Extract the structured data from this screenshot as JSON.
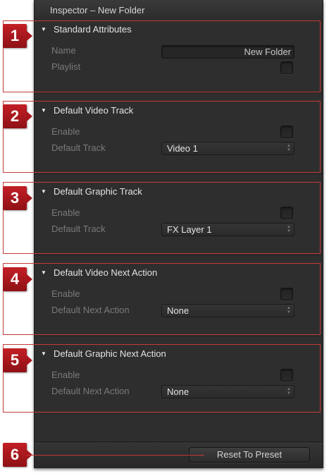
{
  "inspector": {
    "title": "Inspector – New Folder"
  },
  "sections": [
    {
      "header": "Standard Attributes",
      "name_label": "Name",
      "name_value": "New Folder",
      "playlist_label": "Playlist"
    },
    {
      "header": "Default Video Track",
      "enable_label": "Enable",
      "track_label": "Default Track",
      "track_value": "Video 1"
    },
    {
      "header": "Default Graphic Track",
      "enable_label": "Enable",
      "track_label": "Default Track",
      "track_value": "FX Layer 1"
    },
    {
      "header": "Default Video Next Action",
      "enable_label": "Enable",
      "action_label": "Default Next Action",
      "action_value": "None"
    },
    {
      "header": "Default Graphic Next Action",
      "enable_label": "Enable",
      "action_label": "Default Next Action",
      "action_value": "None"
    }
  ],
  "footer": {
    "reset_label": "Reset To Preset"
  },
  "callouts": [
    "1",
    "2",
    "3",
    "4",
    "5",
    "6"
  ],
  "colors": {
    "panel_bg": "#2e2e2e",
    "callout_red": "#c21f25"
  },
  "icons": {
    "disclosure": "disclosure-triangle-icon",
    "popup": "popup-arrows-icon"
  }
}
